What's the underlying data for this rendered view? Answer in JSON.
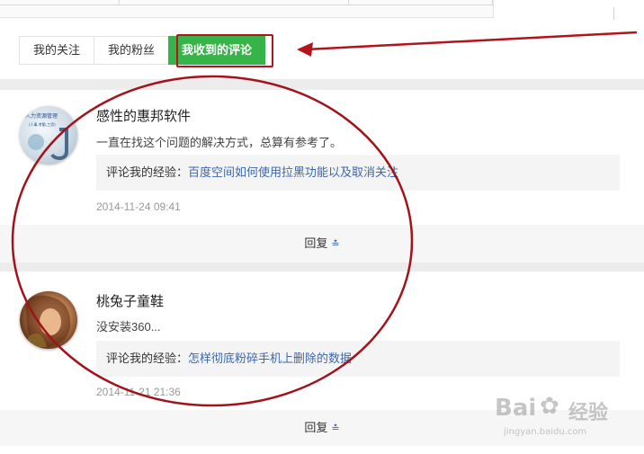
{
  "tabs": [
    {
      "label": "我的关注"
    },
    {
      "label": "我的粉丝"
    },
    {
      "label": "我收到的评论"
    }
  ],
  "comments": [
    {
      "username": "感性的惠邦软件",
      "avatar_text": "人力资源管理",
      "avatar_sub": "(人事,考勤,工资)",
      "content": "一直在找这个问题的解决方式，总算有参考了。",
      "quote_label": "评论我的经验：",
      "quote_link": "百度空间如何使用拉黑功能以及取消关注",
      "time": "2014-11-24 09:41",
      "reply": "回复"
    },
    {
      "username": "桃兔子童鞋",
      "content": "没安装360...",
      "quote_label": "评论我的经验：",
      "quote_link": "怎样彻底粉碎手机上删除的数据",
      "time": "2014-11-21 21:36",
      "reply": "回复"
    }
  ],
  "watermark": {
    "brand": "Bai",
    "suffix": "经验",
    "url": "jingyan.baidu.com"
  },
  "colors": {
    "accent_green": "#36b449",
    "link_blue": "#3a67b1",
    "annotation_red": "#b3141c"
  }
}
